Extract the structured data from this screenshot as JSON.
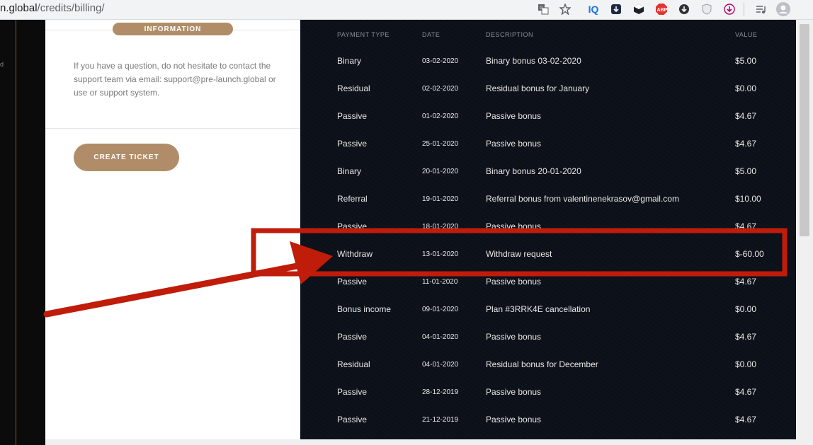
{
  "browser": {
    "url_host": "n.global",
    "url_path": "/credits/billing/",
    "extensions": [
      "translate-icon",
      "star-icon",
      "iq-icon",
      "download-icon",
      "cube-icon",
      "adblock-icon",
      "download-circle-icon",
      "shield-icon",
      "download-pink-icon",
      "media-icon",
      "profile-icon"
    ],
    "iq_label": "IQ",
    "abp_label": "ABP"
  },
  "left_strip": {
    "tiny_text": "d"
  },
  "info": {
    "pill_label": "INFORMATION",
    "text": "If you have a question, do not hesitate to contact the support team via email: support@pre-launch.global or use or support system.",
    "button_label": "CREATE TICKET"
  },
  "table": {
    "headers": {
      "type": "PAYMENT TYPE",
      "date": "DATE",
      "desc": "DESCRIPTION",
      "value": "VALUE"
    },
    "rows": [
      {
        "type": "Binary",
        "date": "03-02-2020",
        "desc": "Binary bonus 03-02-2020",
        "value": "$5.00"
      },
      {
        "type": "Residual",
        "date": "02-02-2020",
        "desc": "Residual bonus for January",
        "value": "$0.00"
      },
      {
        "type": "Passive",
        "date": "01-02-2020",
        "desc": "Passive bonus",
        "value": "$4.67"
      },
      {
        "type": "Passive",
        "date": "25-01-2020",
        "desc": "Passive bonus",
        "value": "$4.67"
      },
      {
        "type": "Binary",
        "date": "20-01-2020",
        "desc": "Binary bonus 20-01-2020",
        "value": "$5.00"
      },
      {
        "type": "Referral",
        "date": "19-01-2020",
        "desc": "Referral bonus from valentinenekrasov@gmail.com",
        "value": "$10.00"
      },
      {
        "type": "Passive",
        "date": "18-01-2020",
        "desc": "Passive bonus",
        "value": "$4.67"
      },
      {
        "type": "Withdraw",
        "date": "13-01-2020",
        "desc": "Withdraw request",
        "value": "$-60.00"
      },
      {
        "type": "Passive",
        "date": "11-01-2020",
        "desc": "Passive bonus",
        "value": "$4.67"
      },
      {
        "type": "Bonus income",
        "date": "09-01-2020",
        "desc": "Plan #3RRK4E cancellation",
        "value": "$0.00"
      },
      {
        "type": "Passive",
        "date": "04-01-2020",
        "desc": "Passive bonus",
        "value": "$4.67"
      },
      {
        "type": "Residual",
        "date": "04-01-2020",
        "desc": "Residual bonus for December",
        "value": "$0.00"
      },
      {
        "type": "Passive",
        "date": "28-12-2019",
        "desc": "Passive bonus",
        "value": "$4.67"
      },
      {
        "type": "Passive",
        "date": "21-12-2019",
        "desc": "Passive bonus",
        "value": "$4.67"
      }
    ]
  },
  "annotation": {
    "color": "#c01c0a",
    "highlighted_row": "Withdraw"
  },
  "colors": {
    "accent": "#b08d68",
    "dark_bg": "#0c1019"
  }
}
